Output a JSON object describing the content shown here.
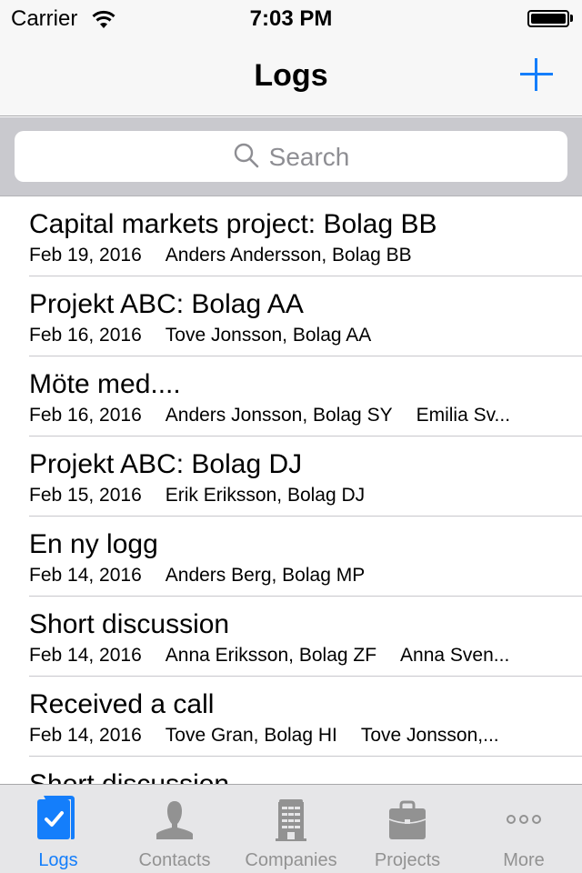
{
  "status_bar": {
    "carrier": "Carrier",
    "time": "7:03 PM",
    "wifi_icon": "wifi-icon",
    "battery_icon": "battery-icon"
  },
  "nav": {
    "title": "Logs",
    "add_icon": "plus-icon"
  },
  "search": {
    "placeholder": "Search",
    "icon": "search-icon"
  },
  "logs": [
    {
      "title": "Capital markets project: Bolag BB",
      "date": "Feb 19, 2016",
      "participants": [
        "Anders Andersson, Bolag BB"
      ]
    },
    {
      "title": "Projekt ABC: Bolag AA",
      "date": "Feb 16, 2016",
      "participants": [
        "Tove Jonsson, Bolag AA"
      ]
    },
    {
      "title": "Möte med....",
      "date": "Feb 16, 2016",
      "participants": [
        "Anders Jonsson, Bolag SY",
        "Emilia Sv..."
      ]
    },
    {
      "title": "Projekt ABC: Bolag DJ",
      "date": "Feb 15, 2016",
      "participants": [
        "Erik Eriksson, Bolag DJ"
      ]
    },
    {
      "title": "En ny logg",
      "date": "Feb 14, 2016",
      "participants": [
        "Anders Berg, Bolag MP"
      ]
    },
    {
      "title": "Short discussion",
      "date": "Feb 14, 2016",
      "participants": [
        "Anna Eriksson, Bolag ZF",
        "Anna Sven..."
      ]
    },
    {
      "title": "Received a call",
      "date": "Feb 14, 2016",
      "participants": [
        "Tove Gran, Bolag HI",
        "Tove Jonsson,..."
      ]
    },
    {
      "title": "Short discussion",
      "date": "",
      "participants": []
    }
  ],
  "tabs": [
    {
      "label": "Logs",
      "icon": "logbook-check-icon",
      "active": true
    },
    {
      "label": "Contacts",
      "icon": "person-icon",
      "active": false
    },
    {
      "label": "Companies",
      "icon": "building-icon",
      "active": false
    },
    {
      "label": "Projects",
      "icon": "briefcase-icon",
      "active": false
    },
    {
      "label": "More",
      "icon": "more-dots-icon",
      "active": false
    }
  ],
  "colors": {
    "accent": "#147efb",
    "tab_inactive": "#929292",
    "search_bar_bg": "#c9c9ce",
    "separator": "#c8c7cc"
  }
}
